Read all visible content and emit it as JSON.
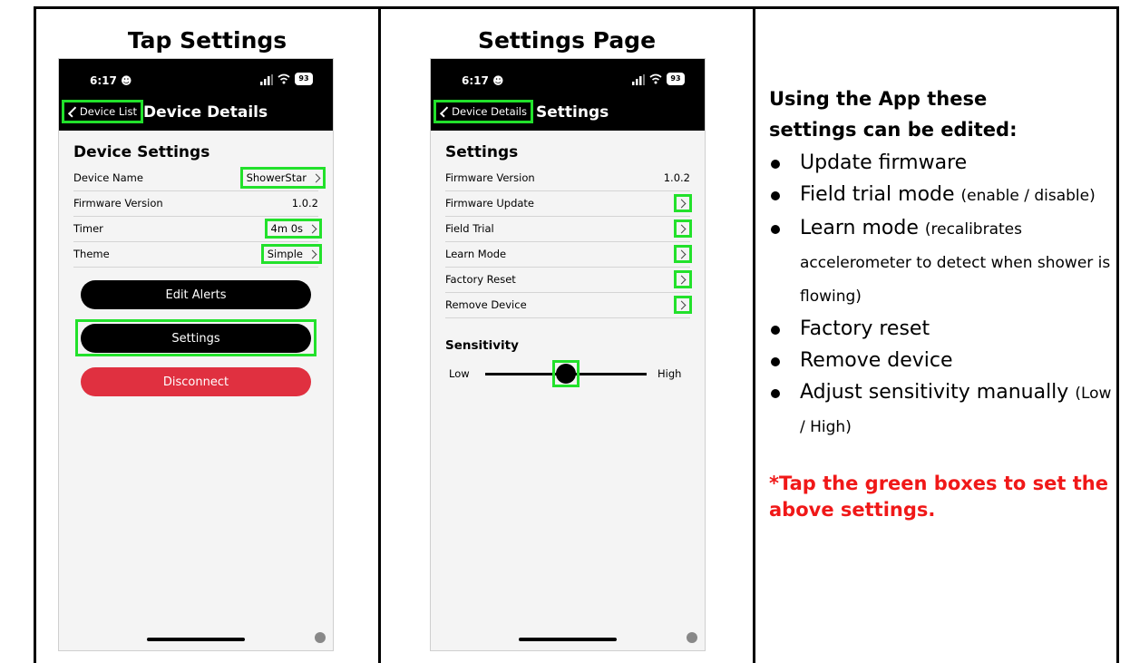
{
  "columns": [
    {
      "title": "Tap Settings"
    },
    {
      "title": "Settings Page"
    }
  ],
  "phone1": {
    "time": "6:17",
    "battery": "93",
    "back_label": "Device List",
    "nav_title": "Device Details",
    "section_title": "Device Settings",
    "rows": [
      {
        "label": "Device Name",
        "value": "ShowerStar"
      },
      {
        "label": "Firmware Version",
        "value": "1.0.2"
      },
      {
        "label": "Timer",
        "value": "4m 0s"
      },
      {
        "label": "Theme",
        "value": "Simple"
      }
    ],
    "edit_alerts_label": "Edit Alerts",
    "settings_label": "Settings",
    "disconnect_label": "Disconnect"
  },
  "phone2": {
    "time": "6:17",
    "battery": "93",
    "back_label": "Device Details",
    "nav_title": "Settings",
    "section_title": "Settings",
    "firmware_label": "Firmware Version",
    "firmware_value": "1.0.2",
    "items": [
      "Firmware Update",
      "Field Trial",
      "Learn Mode",
      "Factory Reset",
      "Remove Device"
    ],
    "sensitivity_title": "Sensitivity",
    "slider_low": "Low",
    "slider_high": "High",
    "slider_level": 0.5
  },
  "info": {
    "heading": "Using the App these settings can be edited:",
    "bullets": [
      {
        "main": "Update firmware",
        "note": ""
      },
      {
        "main": "Field trial mode",
        "note": "(enable / disable)"
      },
      {
        "main": "Learn mode",
        "note": "(recalibrates accelerometer to detect when shower is flowing)"
      },
      {
        "main": "Factory reset",
        "note": ""
      },
      {
        "main": "Remove device",
        "note": ""
      },
      {
        "main": "Adjust sensitivity manually",
        "note": "(Low / High)"
      }
    ],
    "note": "*Tap the green boxes to set the above settings."
  },
  "colors": {
    "highlight": "#22e12b",
    "disconnect": "#e03040",
    "note": "#f01818"
  }
}
